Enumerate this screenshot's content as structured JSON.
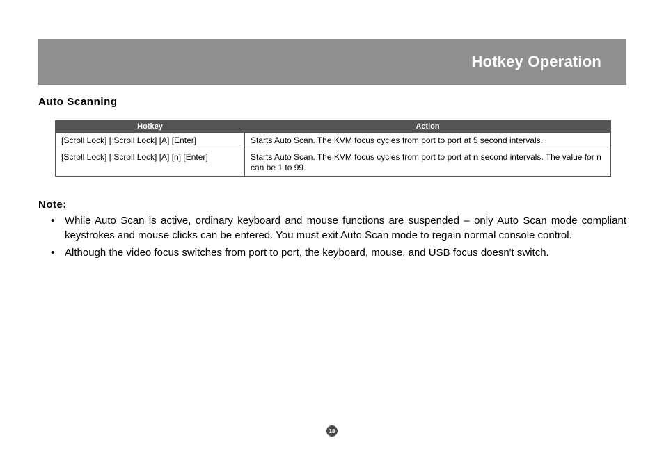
{
  "header": {
    "title": "Hotkey Operation"
  },
  "section": {
    "title": "Auto Scanning"
  },
  "table": {
    "headers": {
      "hotkey": "Hotkey",
      "action": "Action"
    },
    "rows": [
      {
        "hotkey": "[Scroll Lock] [ Scroll Lock] [A] [Enter]",
        "action": "Starts Auto Scan.  The KVM focus cycles from port to port at 5 second intervals."
      },
      {
        "hotkey": "[Scroll Lock] [ Scroll Lock] [A] [n] [Enter]",
        "action_pre": "Starts Auto Scan.  The KVM focus cycles from port to port at ",
        "action_bold": "n",
        "action_post": " second intervals.  The value for n can be 1 to 99."
      }
    ]
  },
  "note": {
    "label": "Note:",
    "items": [
      "While Auto Scan is active, ordinary keyboard and mouse functions are suspended – only Auto Scan mode compliant keystrokes and mouse clicks can be entered.  You must exit Auto Scan mode to regain normal console control.",
      "Although the video focus switches from port to port, the keyboard, mouse, and USB focus doesn't switch."
    ]
  },
  "page_number": "18"
}
